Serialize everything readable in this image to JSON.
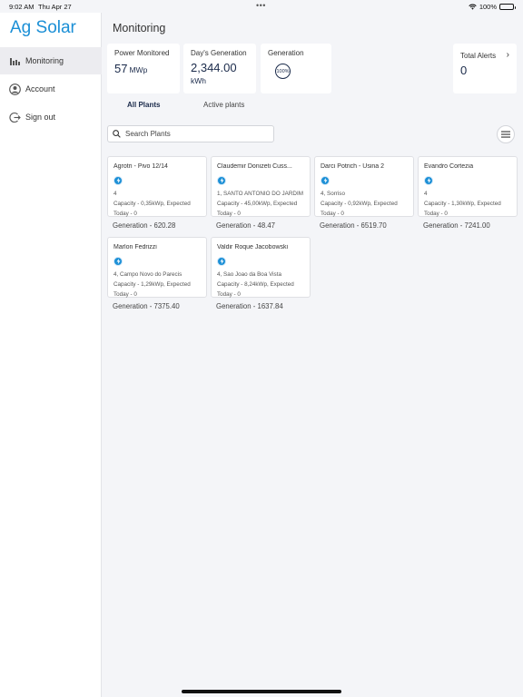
{
  "status_bar": {
    "time": "9:02 AM",
    "date": "Thu Apr 27",
    "dots": "•••",
    "battery": "100%"
  },
  "sidebar": {
    "brand": "Ag Solar",
    "items": [
      {
        "label": "Monitoring",
        "icon": "chart-icon",
        "active": true
      },
      {
        "label": "Account",
        "icon": "account-icon",
        "active": false
      },
      {
        "label": "Sign out",
        "icon": "sign-out-icon",
        "active": false
      }
    ]
  },
  "main": {
    "title": "Monitoring",
    "stats": {
      "power": {
        "label": "Power Monitored",
        "value": "57",
        "unit": "MWp"
      },
      "day": {
        "label": "Day's Generation",
        "value": "2,344.00",
        "unit": "kWh"
      },
      "generation": {
        "label": "Generation",
        "gauge": "100%"
      },
      "alerts": {
        "label": "Total Alerts",
        "value": "0"
      }
    },
    "tabs": [
      {
        "label": "All Plants",
        "active": true
      },
      {
        "label": "Active plants",
        "active": false
      }
    ],
    "search": {
      "placeholder": "Search Plants",
      "value": ""
    },
    "plants": [
      {
        "name": "Agrotri - Pivo 12/14",
        "location": "4",
        "capacity": "Capacity - 0,35kWp, Expected",
        "today": "Today - 0",
        "generation": "Generation - 620.28"
      },
      {
        "name": "Claudemir Donizeti Cuss...",
        "location": "1, SANTO ANTONIO DO JARDIM",
        "capacity": "Capacity - 45,00kWp, Expected",
        "today": "Today - 0",
        "generation": "Generation - 48.47"
      },
      {
        "name": "Darci Potrich - Usina 2",
        "location": "4, Sorriso",
        "capacity": "Capacity - 0,92kWp, Expected",
        "today": "Today - 0",
        "generation": "Generation - 6519.70"
      },
      {
        "name": "Evandro Cortezia",
        "location": "4",
        "capacity": "Capacity - 1,30kWp, Expected",
        "today": "Today - 0",
        "generation": "Generation - 7241.00"
      },
      {
        "name": "Marlon Fedrizzi",
        "location": "4, Campo Novo do Parecis",
        "capacity": "Capacity - 1,29kWp, Expected",
        "today": "Today - 0",
        "generation": "Generation - 7375.40"
      },
      {
        "name": "Valdir Roque Jacobowski",
        "location": "4, Sao Joao da Boa Vista",
        "capacity": "Capacity - 8,24kWp, Expected",
        "today": "Today - 0",
        "generation": "Generation - 1637.84"
      }
    ]
  },
  "colors": {
    "accent": "#1b8fd6",
    "navy": "#1a2a4a",
    "background": "#f4f5f8"
  }
}
